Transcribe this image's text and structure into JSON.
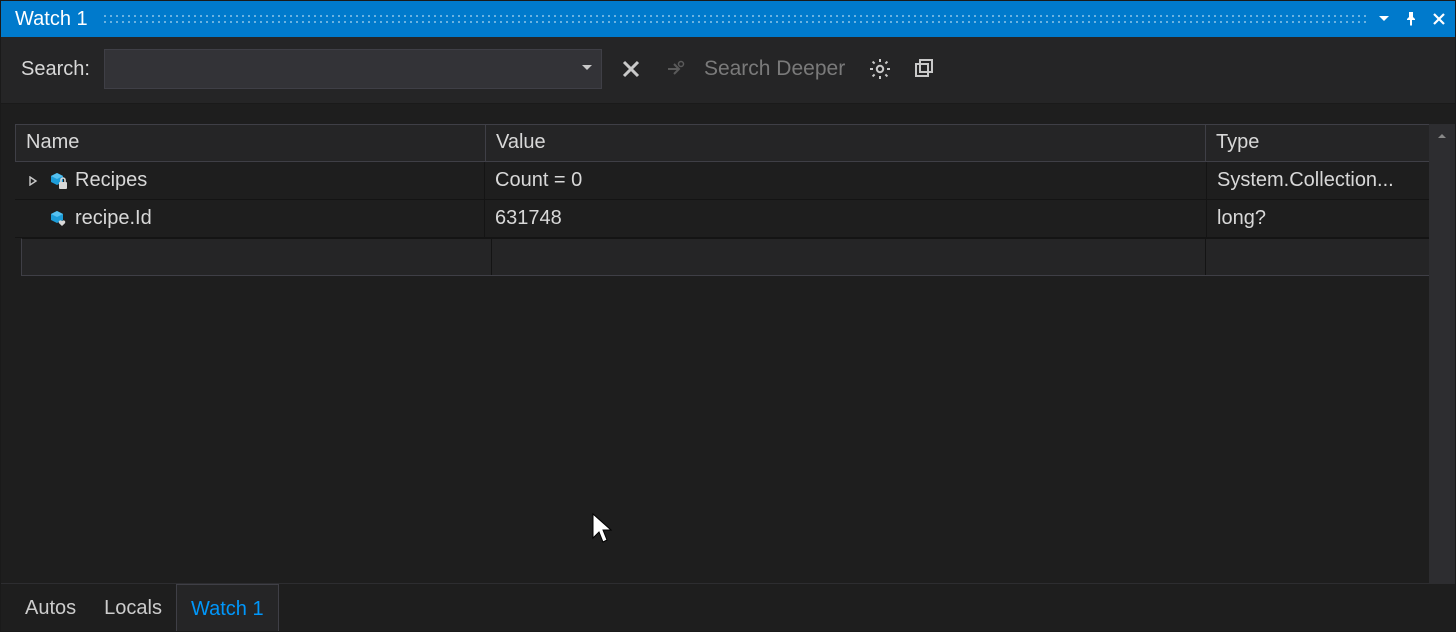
{
  "titlebar": {
    "title": "Watch 1"
  },
  "toolbar": {
    "search_label": "Search:",
    "search_value": "",
    "search_deeper_label": "Search Deeper"
  },
  "grid": {
    "headers": {
      "name": "Name",
      "value": "Value",
      "type": "Type"
    },
    "rows": [
      {
        "expandable": true,
        "icon": "cube-locked",
        "name": "Recipes",
        "value": "Count = 0",
        "type": "System.Collection..."
      },
      {
        "expandable": false,
        "icon": "cube-heart",
        "name": "recipe.Id",
        "value": "631748",
        "type": "long?"
      }
    ]
  },
  "tabs": [
    {
      "label": "Autos",
      "active": false
    },
    {
      "label": "Locals",
      "active": false
    },
    {
      "label": "Watch 1",
      "active": true
    }
  ]
}
